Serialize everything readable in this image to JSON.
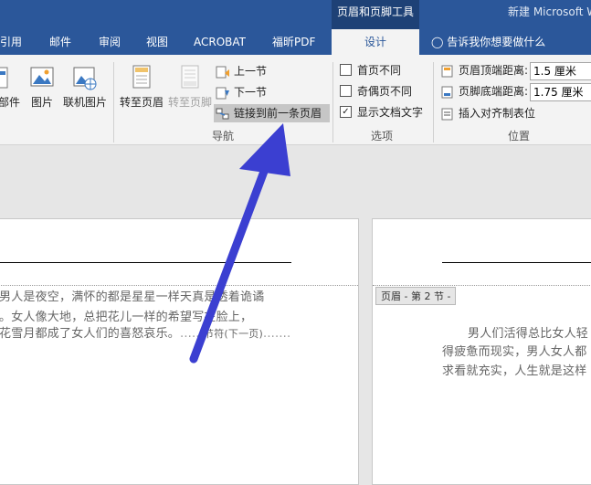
{
  "titlebar": {
    "context_tool": "页眉和页脚工具",
    "doc_title": "新建 Microsoft W"
  },
  "tabs": [
    {
      "label": "引用"
    },
    {
      "label": "邮件"
    },
    {
      "label": "审阅"
    },
    {
      "label": "视图"
    },
    {
      "label": "ACROBAT"
    },
    {
      "label": "福昕PDF"
    },
    {
      "label": "设计"
    }
  ],
  "tell_me": "告诉我你想要做什么",
  "ribbon": {
    "insert_group": {
      "parts": "部件",
      "picture": "图片",
      "online_picture": "联机图片"
    },
    "nav_group": {
      "goto_header": "转至页眉",
      "goto_footer": "转至页脚",
      "prev_section": "上一节",
      "next_section": "下一节",
      "link_previous": "链接到前一条页眉",
      "label": "导航"
    },
    "options_group": {
      "diff_first": "首页不同",
      "diff_odd_even": "奇偶页不同",
      "show_doc_text": "显示文档文字",
      "show_doc_text_checked": true,
      "label": "选项"
    },
    "position_group": {
      "header_top_label": "页眉顶端距离:",
      "header_top_value": "1.5 厘米",
      "footer_bottom_label": "页脚底端距离:",
      "footer_bottom_value": "1.75 厘米",
      "insert_align_tab": "插入对齐制表位",
      "label": "位置"
    }
  },
  "document": {
    "left_page": {
      "line1": "男人是夜空，满怀的都是星星一样天真是透着诡谲",
      "line2": "。女人像大地，总把花儿一样的希望写在脸上，",
      "line3": "花雪月都成了女人们的喜怒哀乐。",
      "section_break": "节符(下一页)"
    },
    "right_page": {
      "header_tag": "页眉 - 第 2 节 -",
      "line1": "男人们活得总比女人轻",
      "line2": "得疲惫而现实，男人女人都",
      "line3": "求看就充实，人生就是这样"
    }
  },
  "colors": {
    "brand": "#2b579a",
    "context_tab": "#1e4176",
    "annotation_arrow": "#3b3fd1"
  }
}
